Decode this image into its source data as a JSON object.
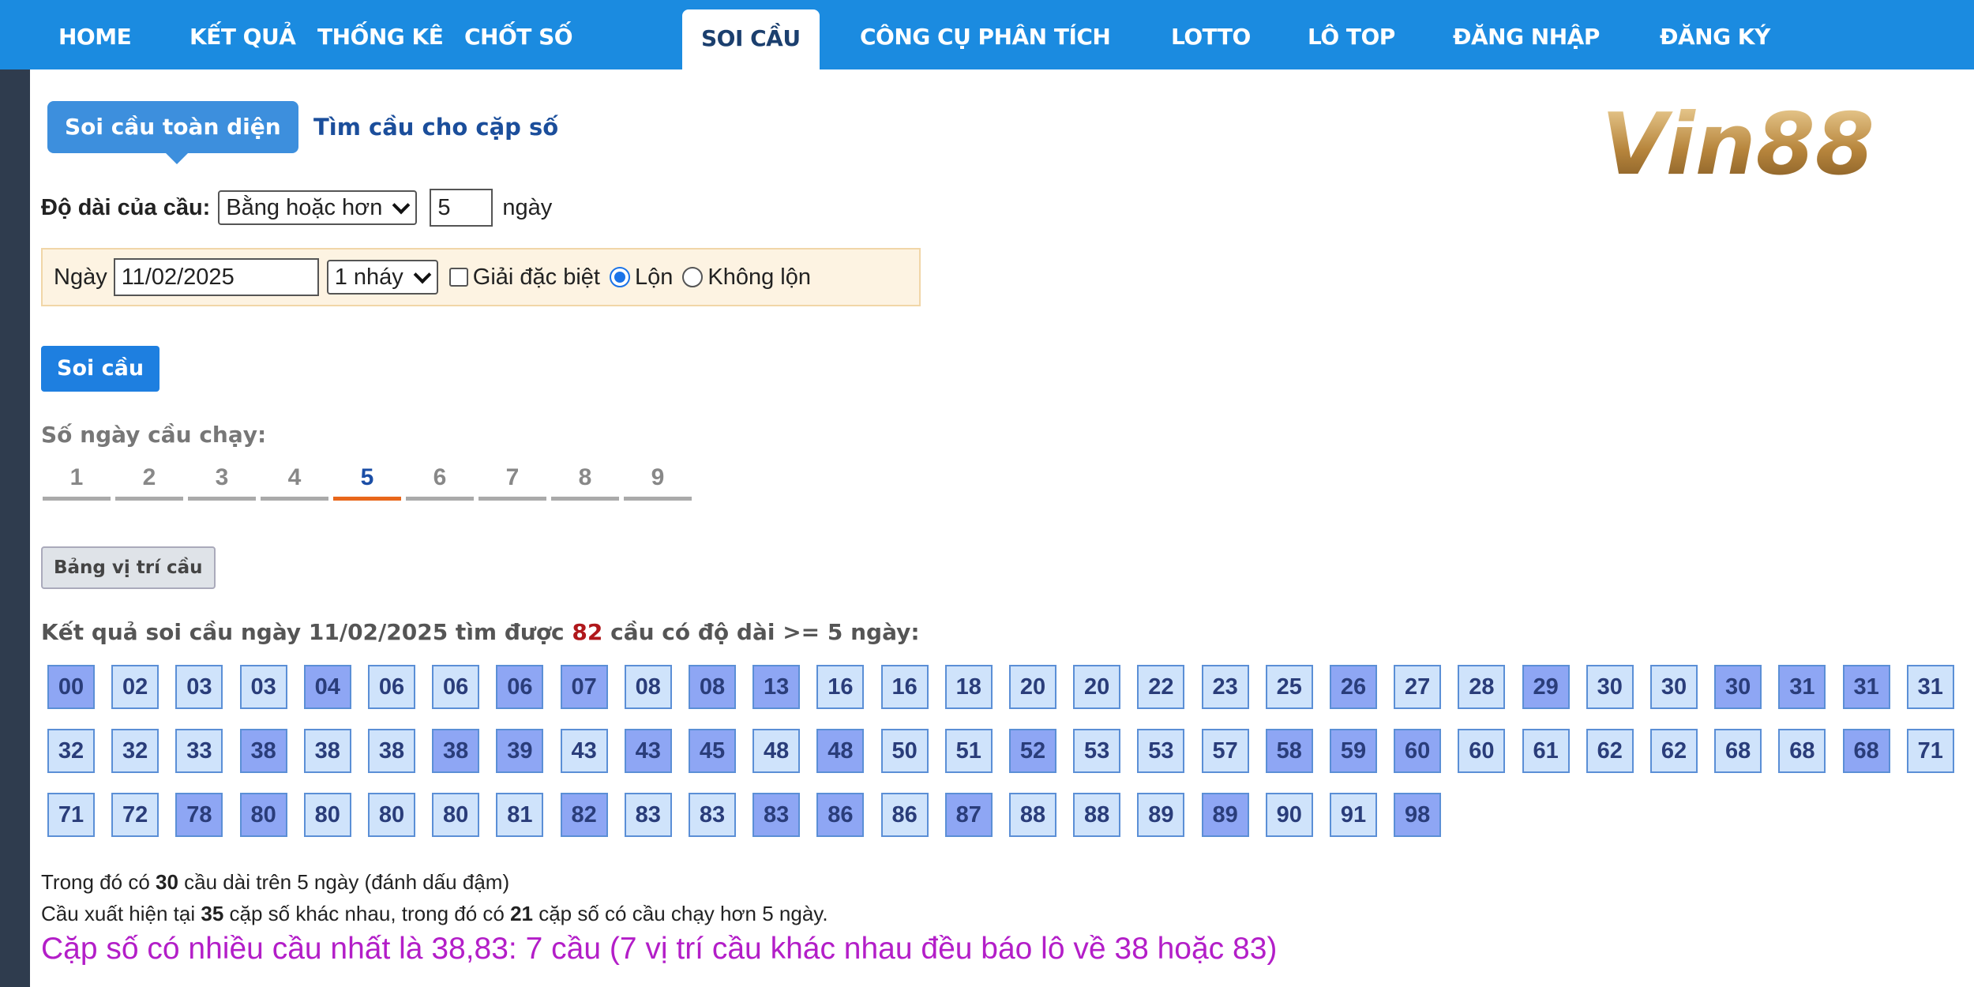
{
  "nav": {
    "items": [
      "HOME",
      "KẾT QUẢ",
      "THỐNG KÊ",
      "CHỐT SỐ",
      "SOI CẦU",
      "CÔNG CỤ PHÂN TÍCH",
      "LOTTO",
      "LÔ TOP",
      "ĐĂNG NHẬP",
      "ĐĂNG KÝ"
    ],
    "active": "SOI CẦU"
  },
  "tabs": {
    "soi_cau": "Soi cầu toàn diện",
    "tim_cau": "Tìm cầu cho cặp số"
  },
  "logo": {
    "text": "Vin88"
  },
  "length": {
    "label": "Độ dài của cầu:",
    "select": "Bằng hoặc hơn",
    "value": "5",
    "unit": "ngày"
  },
  "filter": {
    "ngay_label": "Ngày",
    "date": "11/02/2025",
    "nhay": "1 nháy",
    "giai_db": "Giải đặc biệt",
    "lon": "Lộn",
    "khong_lon": "Không lộn"
  },
  "buttons": {
    "soi_cau": "Soi cầu",
    "bang_vi_tri": "Bảng vị trí cầu"
  },
  "days": {
    "label": "Số ngày cầu chạy:",
    "items": [
      "1",
      "2",
      "3",
      "4",
      "5",
      "6",
      "7",
      "8",
      "9"
    ],
    "active": "5"
  },
  "result": {
    "prefix": "Kết quả soi cầu ngày 11/02/2025 tìm được ",
    "count": "82",
    "suffix": " cầu có độ dài >= 5 ngày:"
  },
  "cells": [
    {
      "v": "00",
      "b": true
    },
    {
      "v": "02",
      "b": false
    },
    {
      "v": "03",
      "b": false
    },
    {
      "v": "03",
      "b": false
    },
    {
      "v": "04",
      "b": true
    },
    {
      "v": "06",
      "b": false
    },
    {
      "v": "06",
      "b": false
    },
    {
      "v": "06",
      "b": true
    },
    {
      "v": "07",
      "b": true
    },
    {
      "v": "08",
      "b": false
    },
    {
      "v": "08",
      "b": true
    },
    {
      "v": "13",
      "b": true
    },
    {
      "v": "16",
      "b": false
    },
    {
      "v": "16",
      "b": false
    },
    {
      "v": "18",
      "b": false
    },
    {
      "v": "20",
      "b": false
    },
    {
      "v": "20",
      "b": false
    },
    {
      "v": "22",
      "b": false
    },
    {
      "v": "23",
      "b": false
    },
    {
      "v": "25",
      "b": false
    },
    {
      "v": "26",
      "b": true
    },
    {
      "v": "27",
      "b": false
    },
    {
      "v": "28",
      "b": false
    },
    {
      "v": "29",
      "b": true
    },
    {
      "v": "30",
      "b": false
    },
    {
      "v": "30",
      "b": false
    },
    {
      "v": "30",
      "b": true
    },
    {
      "v": "31",
      "b": true
    },
    {
      "v": "31",
      "b": true
    },
    {
      "v": "31",
      "b": false
    },
    {
      "v": "32",
      "b": false
    },
    {
      "v": "32",
      "b": false
    },
    {
      "v": "33",
      "b": false
    },
    {
      "v": "38",
      "b": true
    },
    {
      "v": "38",
      "b": false
    },
    {
      "v": "38",
      "b": false
    },
    {
      "v": "38",
      "b": true
    },
    {
      "v": "39",
      "b": true
    },
    {
      "v": "43",
      "b": false
    },
    {
      "v": "43",
      "b": true
    },
    {
      "v": "45",
      "b": true
    },
    {
      "v": "48",
      "b": false
    },
    {
      "v": "48",
      "b": true
    },
    {
      "v": "50",
      "b": false
    },
    {
      "v": "51",
      "b": false
    },
    {
      "v": "52",
      "b": true
    },
    {
      "v": "53",
      "b": false
    },
    {
      "v": "53",
      "b": false
    },
    {
      "v": "57",
      "b": false
    },
    {
      "v": "58",
      "b": true
    },
    {
      "v": "59",
      "b": true
    },
    {
      "v": "60",
      "b": true
    },
    {
      "v": "60",
      "b": false
    },
    {
      "v": "61",
      "b": false
    },
    {
      "v": "62",
      "b": false
    },
    {
      "v": "62",
      "b": false
    },
    {
      "v": "68",
      "b": false
    },
    {
      "v": "68",
      "b": false
    },
    {
      "v": "68",
      "b": true
    },
    {
      "v": "71",
      "b": false
    },
    {
      "v": "71",
      "b": false
    },
    {
      "v": "72",
      "b": false
    },
    {
      "v": "78",
      "b": true
    },
    {
      "v": "80",
      "b": true
    },
    {
      "v": "80",
      "b": false
    },
    {
      "v": "80",
      "b": false
    },
    {
      "v": "80",
      "b": false
    },
    {
      "v": "81",
      "b": false
    },
    {
      "v": "82",
      "b": true
    },
    {
      "v": "83",
      "b": false
    },
    {
      "v": "83",
      "b": false
    },
    {
      "v": "83",
      "b": true
    },
    {
      "v": "86",
      "b": true
    },
    {
      "v": "86",
      "b": false
    },
    {
      "v": "87",
      "b": true
    },
    {
      "v": "88",
      "b": false
    },
    {
      "v": "88",
      "b": false
    },
    {
      "v": "89",
      "b": false
    },
    {
      "v": "89",
      "b": true
    },
    {
      "v": "90",
      "b": false
    },
    {
      "v": "91",
      "b": false
    },
    {
      "v": "98",
      "b": true
    }
  ],
  "notes": {
    "n1_a": "Trong đó có ",
    "n1_b": "30",
    "n1_c": " cầu dài trên 5 ngày (đánh dấu đậm)",
    "n2_a": "Cầu xuất hiện tại ",
    "n2_b": "35",
    "n2_c": " cặp số khác nhau, trong đó có ",
    "n2_d": "21",
    "n2_e": " cặp số có cầu chạy hơn 5 ngày.",
    "n3": "Cặp số có nhiều cầu nhất là 38,83: 7 cầu (7 vị trí cầu khác nhau đều báo lô về 38 hoặc 83)"
  },
  "colors": {
    "nav_bg": "#1b8be0",
    "cell_bg": "#cfe3fb",
    "cell_bold_bg": "#8ea6f4",
    "accent_orange": "#e8671b",
    "highlight_text": "#b31ec8"
  }
}
